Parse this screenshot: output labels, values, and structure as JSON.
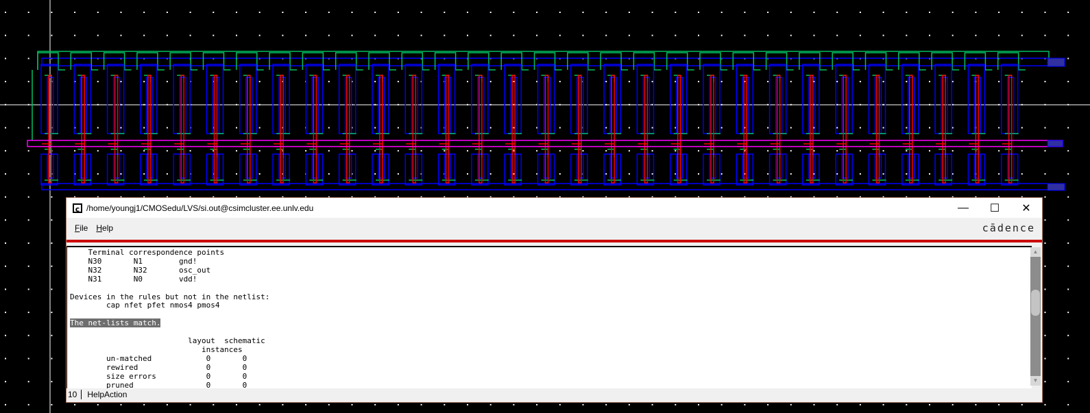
{
  "layout_view": {
    "cell_count": 30,
    "colors": {
      "diffusion": "#00c060",
      "metal1": "#0000ff",
      "poly": "#ff0000",
      "metal2": "#ff00ff",
      "grid": "#ffffff"
    }
  },
  "window": {
    "title": "/home/youngj1/CMOSedu/LVS/si.out@csimcluster.ee.unlv.edu",
    "icon": "cadence-c-icon",
    "controls": {
      "minimize": "—",
      "maximize": "☐",
      "close": "✕"
    },
    "menu": [
      "File",
      "Help"
    ],
    "brand": "cādence",
    "output_lines": [
      "    Terminal correspondence points",
      "    N30       N1        gnd!",
      "    N32       N32       osc_out",
      "    N31       N0        vdd!",
      "",
      "Devices in the rules but not in the netlist:",
      "        cap nfet pfet nmos4 pmos4",
      "",
      "The net-lists match.",
      "",
      "                          layout  schematic",
      "                             instances",
      "        un-matched            0       0",
      "        rewired               0       0",
      "        size errors           0       0",
      "        pruned                0       0"
    ],
    "highlighted_line": 8,
    "scroll_position": 0.35,
    "status": {
      "number": "10",
      "action": "HelpAction"
    }
  }
}
